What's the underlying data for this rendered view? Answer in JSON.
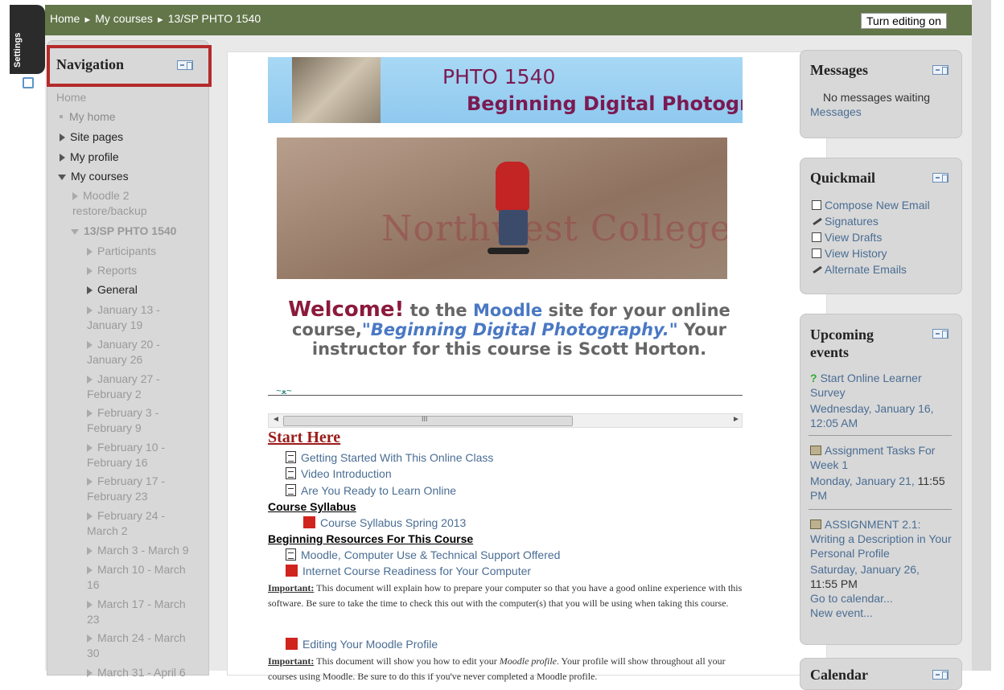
{
  "settings": {
    "label": "Settings"
  },
  "breadcrumb": {
    "home": "Home",
    "my_courses": "My courses",
    "course": "13/SP PHTO 1540",
    "separator": "►"
  },
  "edit_button": "Turn editing on",
  "navigation": {
    "title": "Navigation",
    "home": "Home",
    "items": [
      {
        "label": "My home"
      },
      {
        "label": "Site pages"
      },
      {
        "label": "My profile"
      },
      {
        "label": "My courses"
      },
      {
        "label": "Moodle 2 restore/backup"
      },
      {
        "label": "13/SP PHTO 1540"
      },
      {
        "label": "Participants"
      },
      {
        "label": "Reports"
      },
      {
        "label": "General"
      },
      {
        "label": "January 13 - January 19"
      },
      {
        "label": "January 20 - January 26"
      },
      {
        "label": "January 27 - February 2"
      },
      {
        "label": "February 3 - February 9"
      },
      {
        "label": "February 10 - February 16"
      },
      {
        "label": "February 17 - February 23"
      },
      {
        "label": "February 24 - March 2"
      },
      {
        "label": "March 3 - March 9"
      },
      {
        "label": "March 10 - March 16"
      },
      {
        "label": "March 17 - March 23"
      },
      {
        "label": "March 24 - March 30"
      },
      {
        "label": "March 31 - April 6"
      }
    ]
  },
  "main": {
    "banner": {
      "line1": "PHTO 1540",
      "line2": "Beginning Digital Photograp"
    },
    "photo": {
      "text": "Northwest College"
    },
    "welcome": {
      "w1": "Welcome!",
      "p1": " to the ",
      "w2": "Moodle",
      "p2": " site for your online course,",
      "w3": "\"Beginning Digital Photography.\"",
      "p3": " Your instructor for this course is Scott Horton."
    },
    "scroll_grip": "III",
    "start_here": "Start Here",
    "start_items": [
      "Getting Started With This Online Class",
      "Video Introduction",
      "Are You Ready to Learn Online"
    ],
    "syllabus_head": "Course Syllabus",
    "syllabus_item": "Course Syllabus Spring 2013",
    "resources_head": "Beginning Resources For This Course",
    "resource_items": [
      "Moodle, Computer Use & Technical Support Offered",
      "Internet Course Readiness for Your Computer"
    ],
    "important_label": "Important:",
    "note1": " This document will explain how to prepare your computer so that you have a good online experience with this software. Be sure to take the time to check this out with the computer(s) that you will be using when taking this course.",
    "profile_item": "Editing Your Moodle Profile",
    "note2a": " This document will show you how to edit your ",
    "note2b": "Moodle profile",
    "note2c": ". Your profile will show throughout all your courses using Moodle. Be sure to do this if you've never completed a Moodle profile."
  },
  "messages": {
    "title": "Messages",
    "status": "No messages waiting",
    "link": "Messages"
  },
  "quickmail": {
    "title": "Quickmail",
    "items": [
      "Compose New Email",
      "Signatures",
      "View Drafts",
      "View History",
      "Alternate Emails"
    ]
  },
  "events": {
    "title": "Upcoming events",
    "e1_title": "Start Online Learner Survey",
    "e1_date": "Wednesday, January 16, 12:05 AM",
    "e2_title": "Assignment Tasks For Week 1",
    "e2_date": "Monday, January 21, ",
    "e2_time": "11:55",
    "e2_pm": "PM",
    "e3_title": "ASSIGNMENT 2.1: Writing a Description in Your Personal Profile",
    "e3_date": "Saturday, January 26,",
    "e3_time": "11:55 PM",
    "goto": "Go to calendar...",
    "new": "New event..."
  },
  "calendar": {
    "title": "Calendar"
  }
}
